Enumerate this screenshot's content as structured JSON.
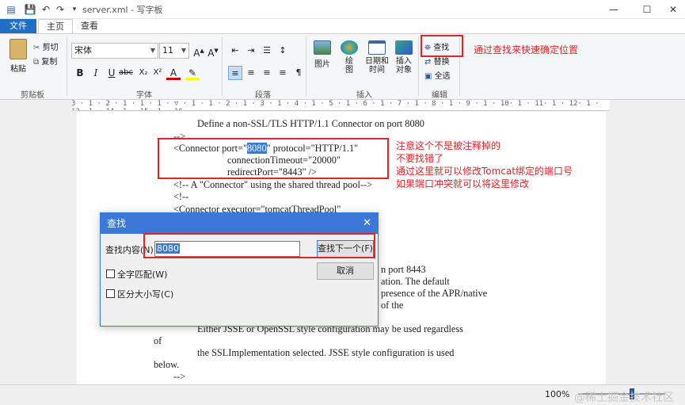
{
  "window": {
    "title": "server.xml - 写字板",
    "minimize": "—",
    "maximize": "☐",
    "close": "✕"
  },
  "tabs": {
    "file": "文件",
    "home": "主页",
    "view": "查看"
  },
  "ribbon": {
    "clipboard": {
      "paste": "粘贴",
      "cut": "剪切",
      "copy": "复制",
      "label": "剪贴板"
    },
    "font": {
      "family": "宋体",
      "size": "11",
      "label": "字体"
    },
    "paragraph": {
      "label": "段落"
    },
    "insert": {
      "picture": "图片",
      "paint": "绘\n图",
      "datetime": "日期和\n时间",
      "object": "插入\n对象",
      "label": "插入"
    },
    "editing": {
      "find": "查找",
      "replace": "替换",
      "select_all": "全选",
      "label": "编辑"
    }
  },
  "ruler": "3 · 1 · 2 · 1 · 1 · 1 · ▽ · 1 · 1 · 2 · 1 · 3 · 1 · 4 · 1 · 5 · 1 · 6 · 1 · 7 · 1 · 8 · 1 · 9 · 1 · 10· 1 · 11· 1 · 12· 1 · 13· 1 · 14· 1 · 15· 1 · 16·",
  "document": {
    "lines": [
      "Define a non-SSL/TLS HTTP/1.1 Connector on port 8080",
      "-->",
      "<Connector port=\"",
      "8080",
      "\" protocol=\"HTTP/1.1\"",
      "connectionTimeout=\"20000\"",
      "redirectPort=\"8443\" />",
      "<!-- A \"Connector\" using the shared thread pool-->",
      "<!--",
      "<Connector executor=\"tomcatThreadPool\"",
      "n port 8443",
      "ation. The default",
      "presence of the APR/native",
      "of the",
      "Either JSSE or OpenSSL style configuration may be used regardless",
      "of",
      "the SSLImplementation selected. JSSE style configuration is used",
      "below.",
      "-->"
    ]
  },
  "annotations": {
    "find_note": "通过查找来快速确定位置",
    "note1": "注意这个不是被注释掉的",
    "note2": "不要找错了",
    "note3": "通过这里就可以修改Tomcat绑定的端口号",
    "note4": "如果端口冲突就可以将这里修改"
  },
  "find_dialog": {
    "title": "查找",
    "find_label": "查找内容(N):",
    "find_value": "8080",
    "find_next": "查找下一个(F)",
    "cancel": "取消",
    "match_whole": "全字匹配(W)",
    "match_case": "区分大小写(C)"
  },
  "status": {
    "zoom": "100%",
    "watermark": "@稀土掘金技术社区"
  }
}
